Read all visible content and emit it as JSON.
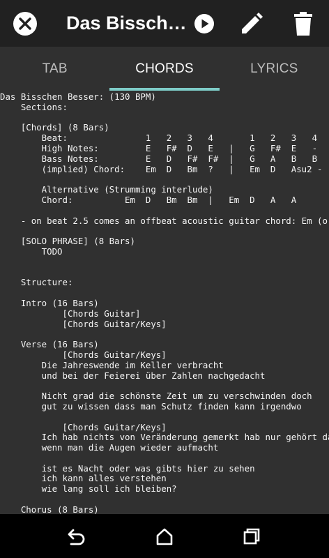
{
  "app_bar": {
    "title": "Das Bissch…",
    "close_icon": "close-icon",
    "play_icon": "play-icon",
    "edit_icon": "pencil-icon",
    "delete_icon": "trash-icon"
  },
  "tabs": [
    {
      "label": "TAB",
      "active": false
    },
    {
      "label": "CHORDS",
      "active": true
    },
    {
      "label": "LYRICS",
      "active": false
    }
  ],
  "chords_text": "Das Bisschen Besser: (130 BPM)\n    Sections:\n\n    [Chords] (8 Bars)\n        Beat:               1   2   3   4       1   2   3   4\n        High Notes:         E   F#  D   E   |   G   F#  E   -\n        Bass Notes:         E   D   F#  F#  |   G   A   B   B\n        (implied) Chord:    Em  D   Bm  ?   |   Em  D   Asu2 -\n\n        Alternative (Strumming interlude)\n        Chord:          Em  D   Bm  Bm  |   Em  D   A   A\n\n    - on beat 2.5 comes an offbeat acoustic guitar chord: Em (or\n\n    [SOLO PHRASE] (8 Bars)\n        TODO\n\n\n    Structure:\n\n    Intro (16 Bars)\n            [Chords Guitar]\n            [Chords Guitar/Keys]\n\n    Verse (16 Bars)\n            [Chords Guitar/Keys]\n        Die Jahreswende im Keller verbracht\n        und bei der Feierei über Zahlen nachgedacht\n\n        Nicht grad die schönste Zeit um zu verschwinden doch\n        gut zu wissen dass man Schutz finden kann irgendwo\n\n            [Chords Guitar/Keys]\n        Ich hab nichts von Veränderung gemerkt hab nur gehört da\n        wenn man die Augen wieder aufmacht\n\n        ist es Nacht oder was gibts hier zu sehen\n        ich kann alles verstehen\n        wie lang soll ich bleiben?\n\n    Chorus (8 Bars)",
  "nav_bar": {
    "back_icon": "back-icon",
    "home_icon": "home-icon",
    "recents_icon": "recents-icon"
  },
  "colors": {
    "app_bar": "#212121",
    "background": "#303030",
    "tab_indicator": "#7ecdc8",
    "nav_bar": "#000000"
  }
}
